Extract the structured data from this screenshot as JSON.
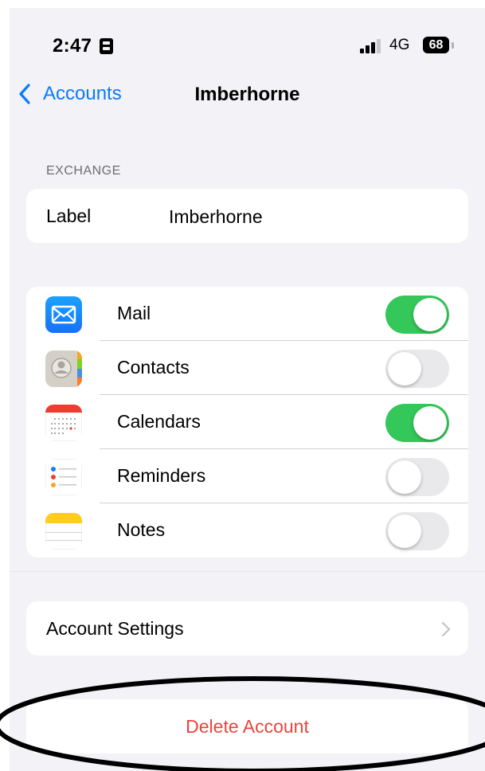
{
  "status_bar": {
    "time": "2:47",
    "network": "4G",
    "battery": "68"
  },
  "nav": {
    "back_label": "Accounts",
    "title": "Imberhorne"
  },
  "section": {
    "header": "EXCHANGE"
  },
  "account": {
    "label_key": "Label",
    "label_value": "Imberhorne"
  },
  "services": [
    {
      "label": "Mail",
      "on": true,
      "icon": "mail-icon"
    },
    {
      "label": "Contacts",
      "on": false,
      "icon": "contacts-icon"
    },
    {
      "label": "Calendars",
      "on": true,
      "icon": "calendar-icon"
    },
    {
      "label": "Reminders",
      "on": false,
      "icon": "reminders-icon"
    },
    {
      "label": "Notes",
      "on": false,
      "icon": "notes-icon"
    }
  ],
  "settings": {
    "account_settings_label": "Account Settings"
  },
  "danger": {
    "delete_label": "Delete Account"
  },
  "colors": {
    "accent": "#0a7aff",
    "toggle_on": "#34c759",
    "destructive": "#e6453b",
    "background": "#f2f2f7"
  }
}
